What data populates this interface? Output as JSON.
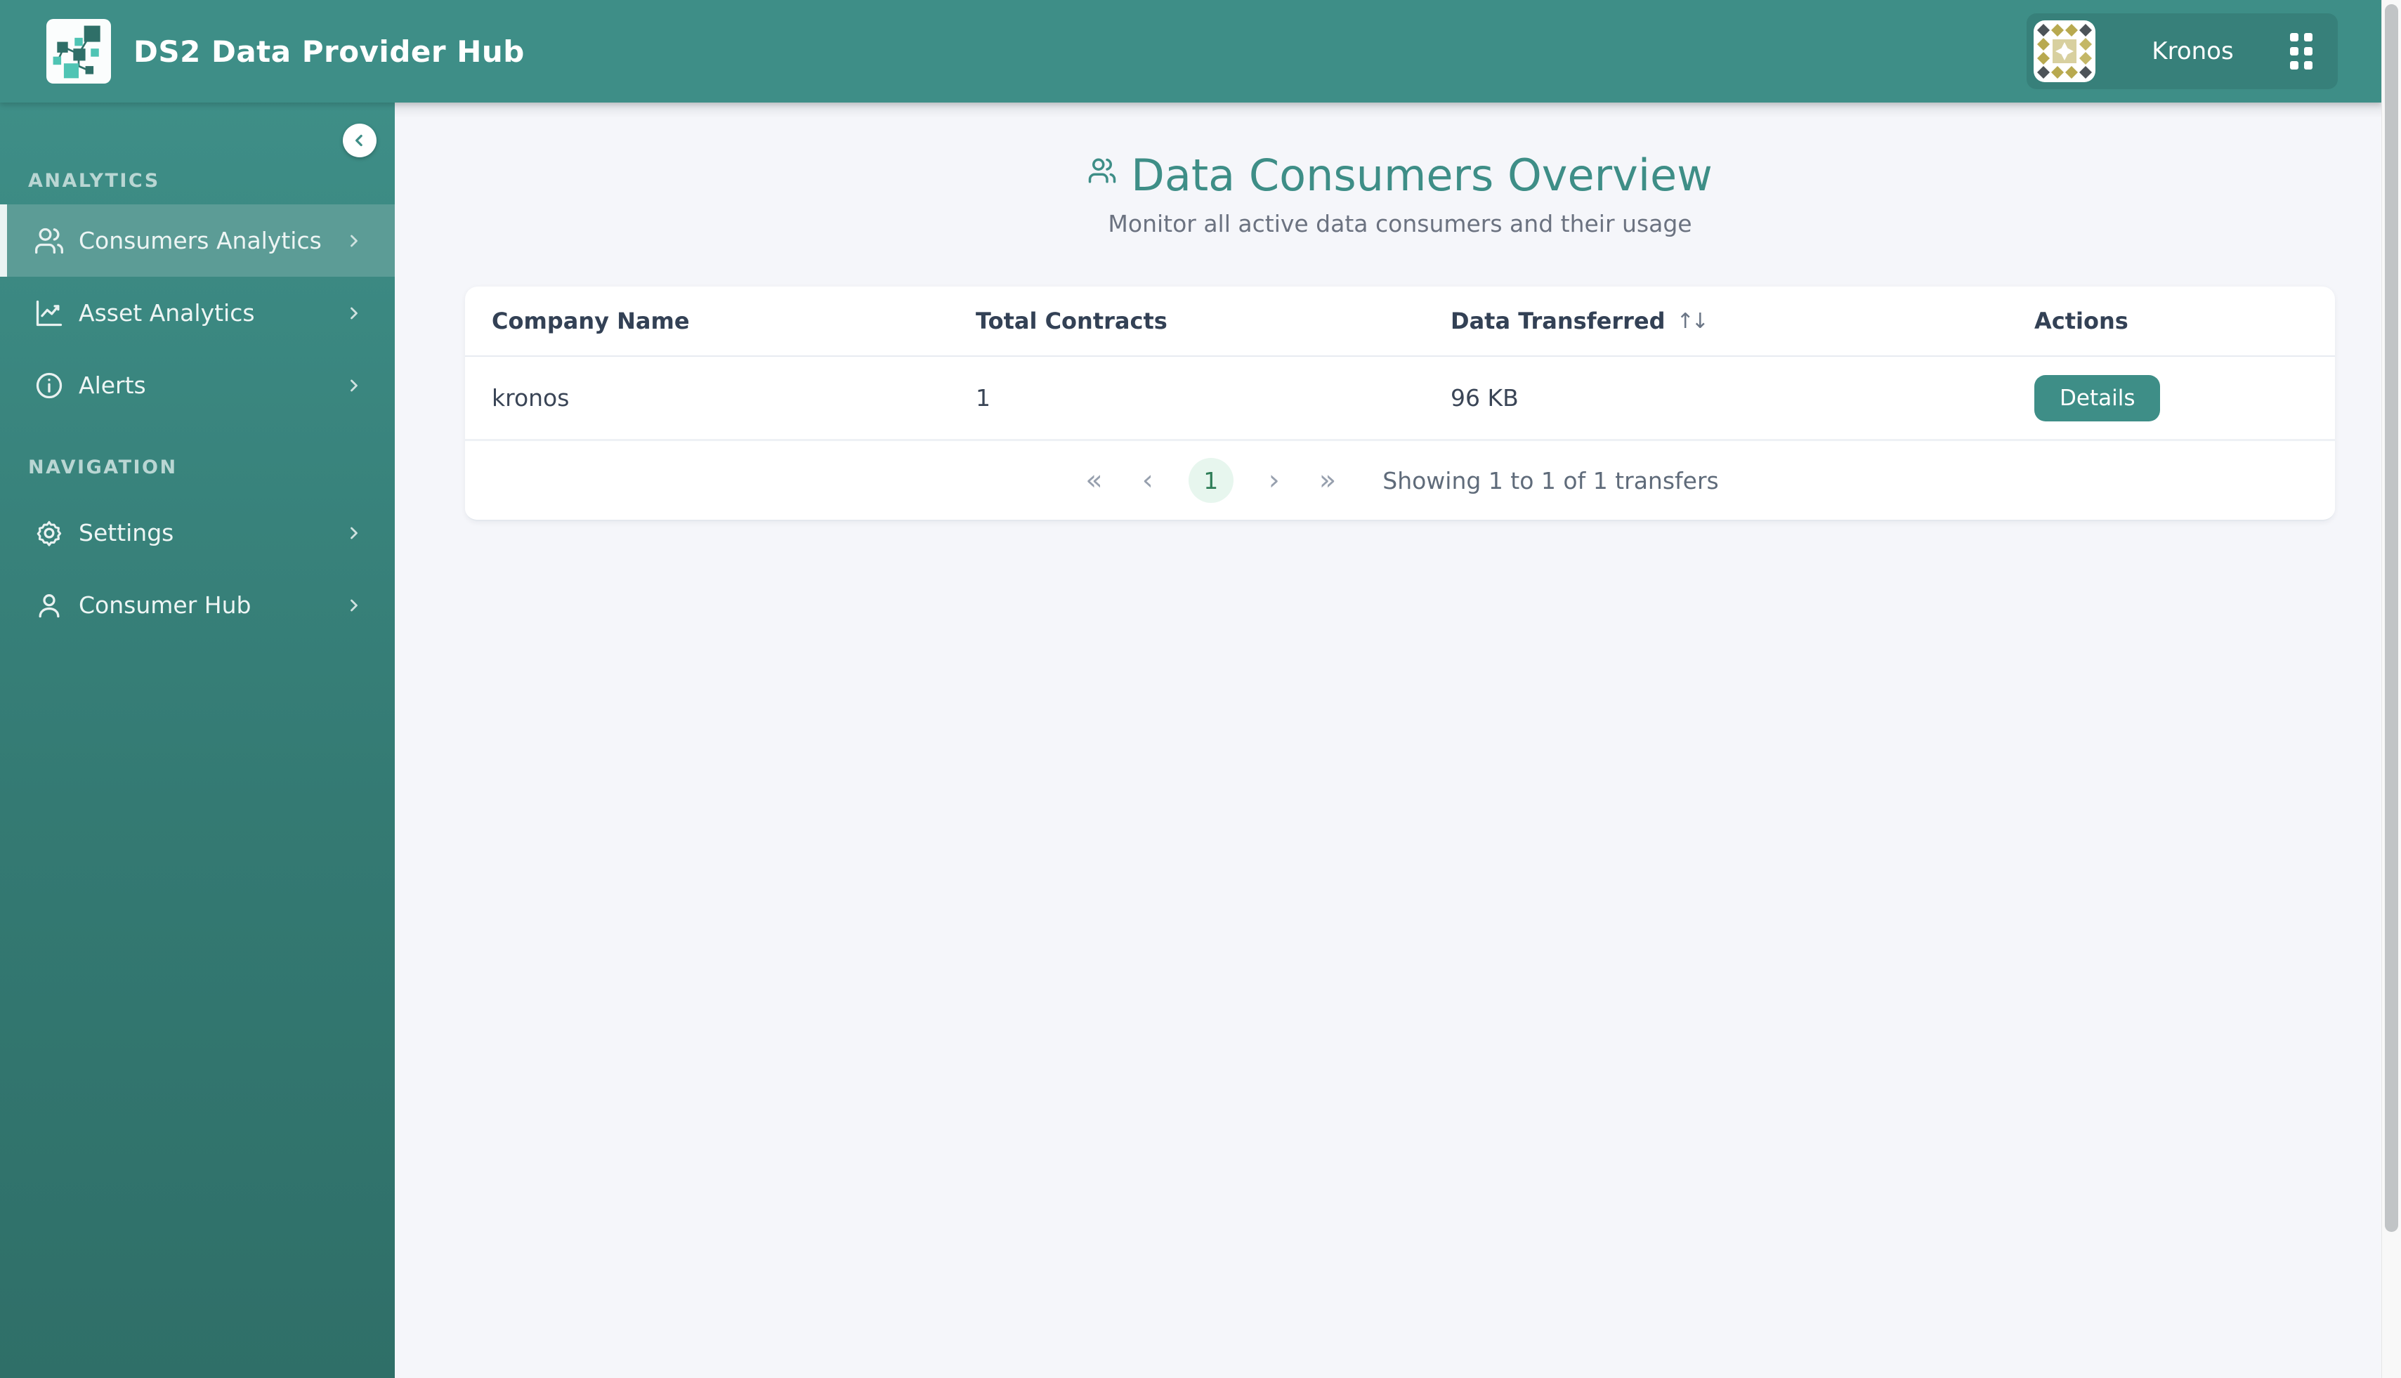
{
  "colors": {
    "accent_teal": "#3E8E87",
    "sidebar_gradient_bottom": "#2F6F68",
    "sidebar_active_bg": "#5C9C96",
    "workspace_pill_bg": "#37807A",
    "page_background": "#F5F6FA",
    "table_header_text": "#334155",
    "subtitle_gray": "#6B7280",
    "pagination_active_bg": "#E7F6EE",
    "pagination_active_text": "#2E7D57",
    "details_button_bg": "#3E8E87",
    "scrollbar_thumb": "#C1C4C6"
  },
  "header": {
    "app_title": "DS2 Data Provider Hub",
    "workspace_name": "Kronos"
  },
  "sidebar": {
    "sections": [
      {
        "label": "ANALYTICS",
        "items": [
          {
            "label": "Consumers Analytics",
            "active": true
          },
          {
            "label": "Asset Analytics",
            "active": false
          },
          {
            "label": "Alerts",
            "active": false
          }
        ]
      },
      {
        "label": "NAVIGATION",
        "items": [
          {
            "label": "Settings",
            "active": false
          },
          {
            "label": "Consumer Hub",
            "active": false
          }
        ]
      }
    ]
  },
  "main": {
    "page_title": "Data Consumers Overview",
    "page_subtitle": "Monitor all active data consumers and their usage",
    "table": {
      "headers": {
        "company": "Company Name",
        "contracts": "Total Contracts",
        "transferred": "Data Transferred",
        "actions": "Actions"
      },
      "sort_icon": "↑↓",
      "rows": [
        {
          "company": "kronos",
          "contracts": "1",
          "transferred": "96 KB",
          "action_label": "Details"
        }
      ]
    },
    "pagination": {
      "first": "«",
      "prev": "‹",
      "page": "1",
      "next": "›",
      "last": "»",
      "summary": "Showing 1 to 1 of 1 transfers"
    }
  }
}
